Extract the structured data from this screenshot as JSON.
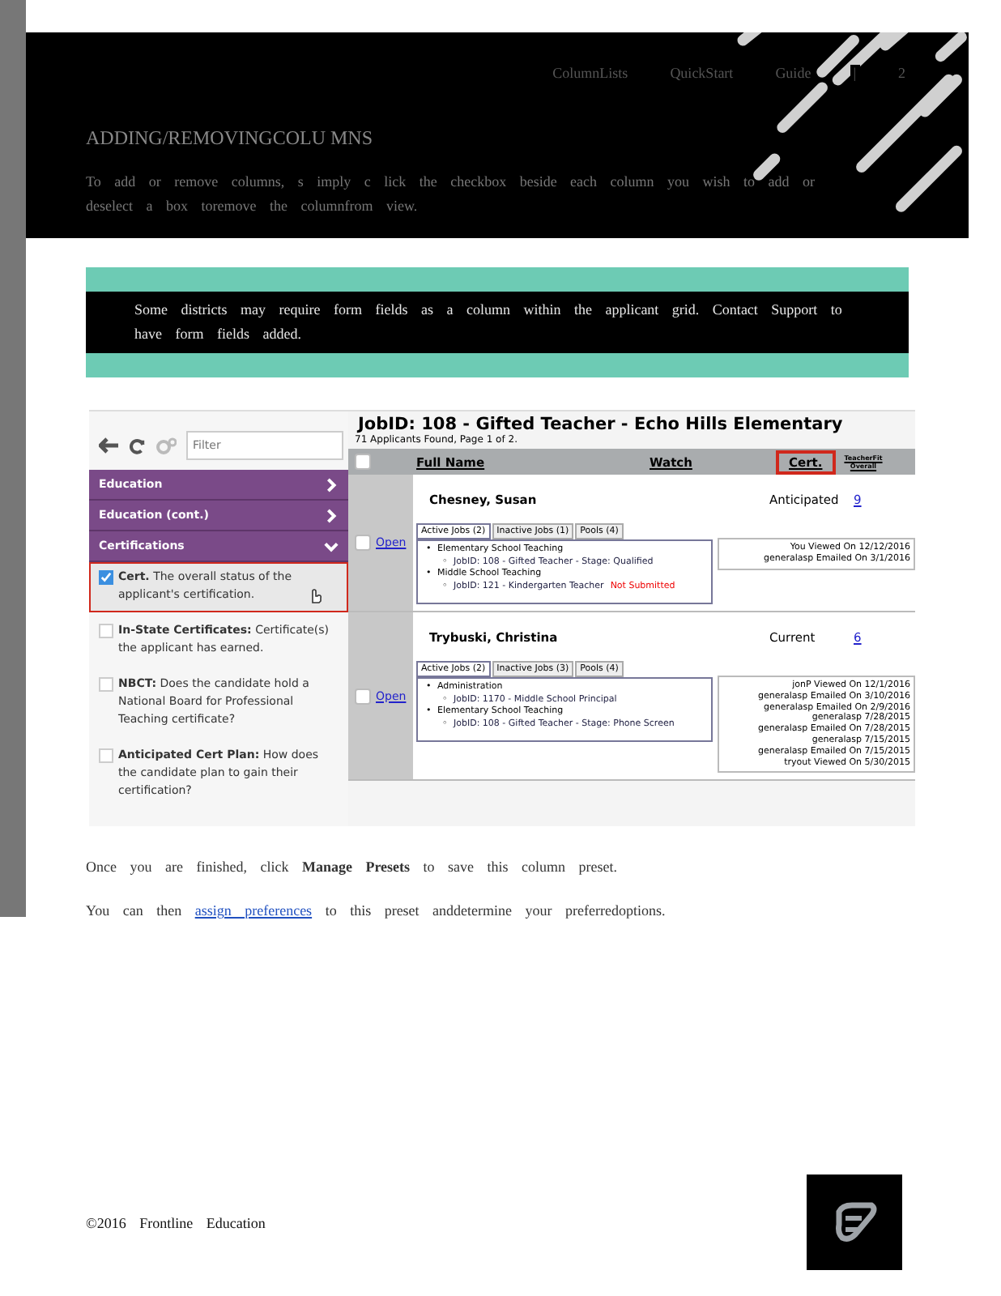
{
  "header": {
    "nav": [
      "ColumnLists",
      "QuickStart",
      "Guide",
      "|",
      "2"
    ],
    "title": "ADDING/REMOVINGCOLU MNS",
    "intro": "To add or remove columns, s imply c lick the checkbox beside each column you wish to add or deselect a box toremove the columnfrom view."
  },
  "note": {
    "text": "Some districts may require form fields as a column within the applicant grid. Contact Support to have form fields added."
  },
  "screenshot": {
    "sidebar": {
      "filter_placeholder": "Filter",
      "sections": [
        {
          "label": "Education",
          "expanded": false
        },
        {
          "label": "Education (cont.)",
          "expanded": false
        },
        {
          "label": "Certifications",
          "expanded": true
        }
      ],
      "options": [
        {
          "name": "Cert.",
          "description": "The overall status of the applicant's certification.",
          "checked": true,
          "highlighted": true
        },
        {
          "name": "In-State Certificates:",
          "description": "Certificate(s) the applicant has earned.",
          "checked": false,
          "highlighted": false
        },
        {
          "name": "NBCT:",
          "description": "Does the candidate hold a National Board for Professional Teaching certificate?",
          "checked": false,
          "highlighted": false
        },
        {
          "name": "Anticipated Cert Plan:",
          "description": "How does the candidate plan to gain their certification?",
          "checked": false,
          "highlighted": false
        }
      ]
    },
    "main": {
      "select_all_checked": false,
      "title": "JobID: 108 - Gifted Teacher - Echo Hills Elementary",
      "subtitle": "71 Applicants Found, Page 1 of 2.",
      "columns": [
        {
          "label": "Full Name",
          "highlighted": false
        },
        {
          "label": "Watch",
          "highlighted": false
        },
        {
          "label": "Cert.",
          "highlighted": true
        },
        {
          "label": "TeacherFit Overall",
          "highlighted": false
        }
      ],
      "rows": [
        {
          "checked": false,
          "open": "Open",
          "name": "Chesney,  Susan",
          "cert": "Anticipated",
          "score": "9",
          "tabs": [
            {
              "label": "Active Jobs (2)",
              "selected": true
            },
            {
              "label": "Inactive Jobs (1)",
              "selected": false
            },
            {
              "label": "Pools (4)",
              "selected": false
            }
          ],
          "jobs": [
            {
              "bullet": "•",
              "text": "Elementary School Teaching",
              "children": [
                {
                  "bullet": "◦",
                  "text": "JobID: 108 - Gifted Teacher - Stage: Qualified"
                }
              ]
            },
            {
              "bullet": "•",
              "text": "Middle School Teaching",
              "children": [
                {
                  "bullet": "◦",
                  "text": "JobID: 121 - Kindergarten Teacher",
                  "flag": "Not Submitted"
                }
              ]
            }
          ],
          "activity": [
            "You Viewed On 12/12/2016",
            "generalasp Emailed On 3/1/2016"
          ]
        },
        {
          "checked": false,
          "open": "Open",
          "name": "Trybuski,  Christina",
          "cert": "Current",
          "score": "6",
          "tabs": [
            {
              "label": "Active Jobs (2)",
              "selected": true
            },
            {
              "label": "Inactive Jobs (3)",
              "selected": false
            },
            {
              "label": "Pools (4)",
              "selected": false
            }
          ],
          "jobs": [
            {
              "bullet": "•",
              "text": "Administration",
              "children": [
                {
                  "bullet": "◦",
                  "text": "JobID: 1170 - Middle School Principal"
                }
              ]
            },
            {
              "bullet": "•",
              "text": "Elementary School Teaching",
              "children": [
                {
                  "bullet": "◦",
                  "text": "JobID: 108 - Gifted Teacher - Stage: Phone Screen"
                }
              ]
            }
          ],
          "activity": [
            "jonP Viewed On 12/1/2016",
            "generalasp Emailed On 3/10/2016",
            "generalasp Emailed On 2/9/2016",
            "generalasp 7/28/2015",
            "generalasp Emailed On 7/28/2015",
            "generalasp 7/15/2015",
            "generalasp Emailed On 7/15/2015",
            "tryout Viewed On 5/30/2015"
          ]
        }
      ]
    }
  },
  "closing": [
    {
      "text": "Once you are finished, click **Manage Presets** to save this column preset."
    },
    {
      "before": "You can then",
      "link": "assign preferences",
      "after": "to this preset anddetermine your preferredoptions."
    }
  ],
  "footer": {
    "copyright": "©2016 Frontline Education"
  }
}
